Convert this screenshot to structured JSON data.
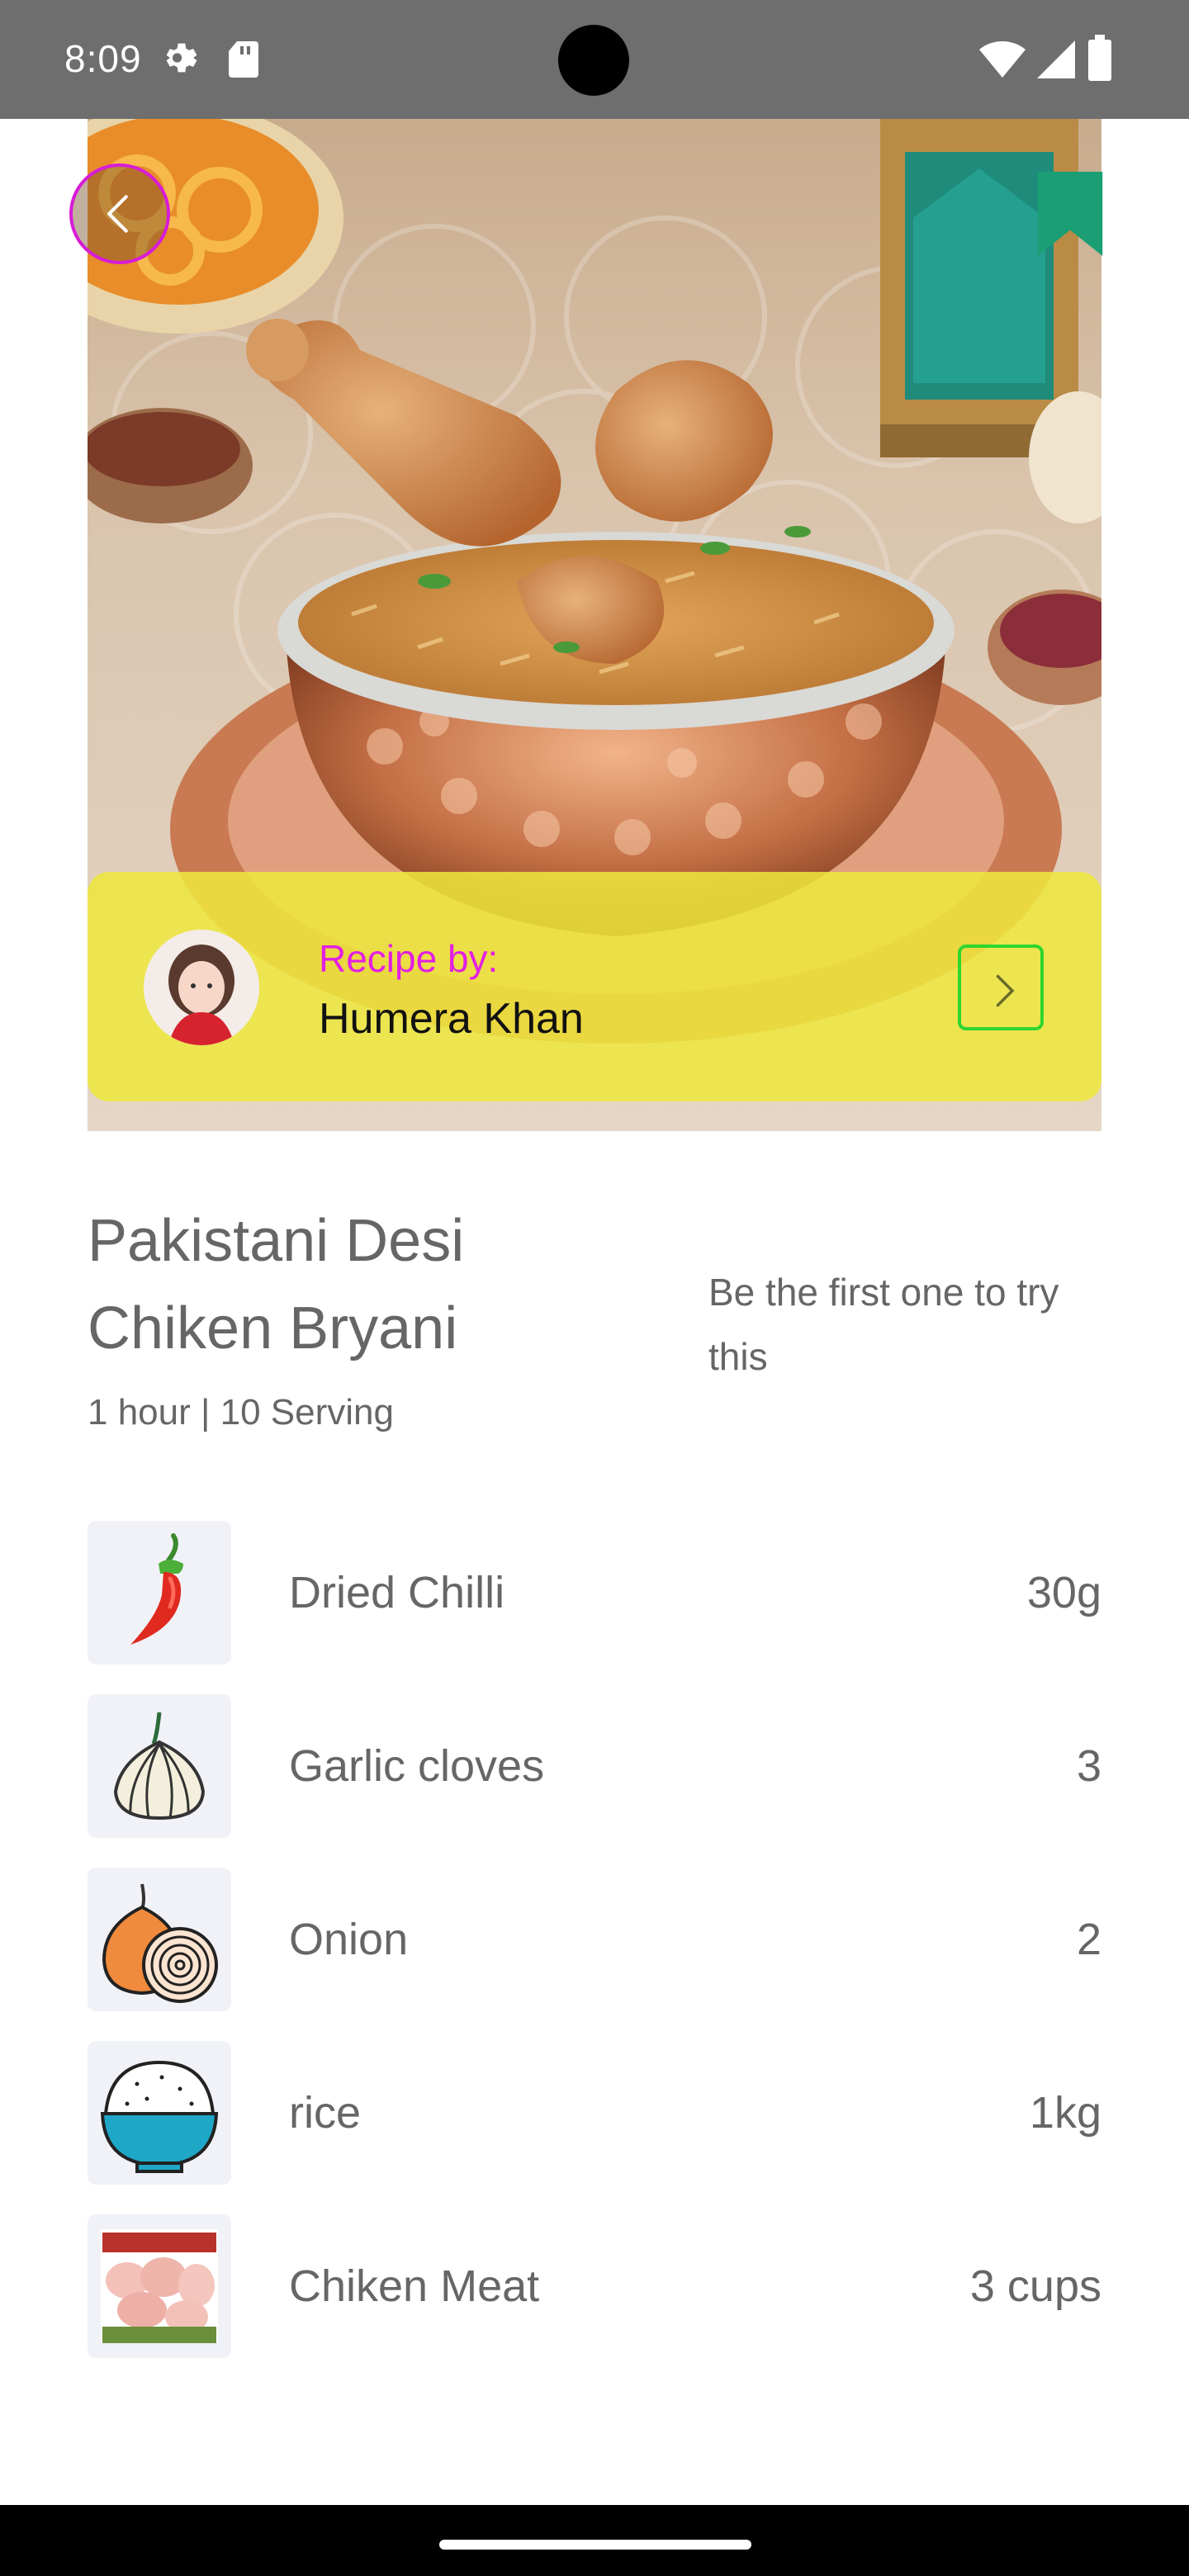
{
  "status_bar": {
    "time": "8:09",
    "icons": [
      "gear-icon",
      "sd-card-icon",
      "wifi-icon",
      "signal-icon",
      "battery-icon"
    ]
  },
  "hero": {
    "image": "chicken-biryani-photo",
    "back_icon": "chevron-left-icon",
    "bookmark_icon": "bookmark-icon"
  },
  "author": {
    "label": "Recipe by:",
    "name": "Humera Khan",
    "arrow_icon": "arrow-right-icon"
  },
  "recipe": {
    "title_line1": "Pakistani Desi",
    "title_line2": "Chiken Bryani",
    "meta": "1 hour | 10 Serving",
    "try_text": "Be the first one to try this"
  },
  "ingredients": [
    {
      "name": "Dried Chilli",
      "qty": "30g",
      "icon": "chilli-icon"
    },
    {
      "name": "Garlic cloves",
      "qty": "3",
      "icon": "garlic-icon"
    },
    {
      "name": "Onion",
      "qty": "2",
      "icon": "onion-icon"
    },
    {
      "name": "rice",
      "qty": "1kg",
      "icon": "rice-bowl-icon"
    },
    {
      "name": "Chiken Meat",
      "qty": "3 cups",
      "icon": "chicken-meat-icon"
    }
  ],
  "colors": {
    "accent_magenta": "#e31fe3",
    "author_bar": "#eee83c",
    "arrow_border": "#2ed62e",
    "bookmark": "#1b9e74"
  }
}
